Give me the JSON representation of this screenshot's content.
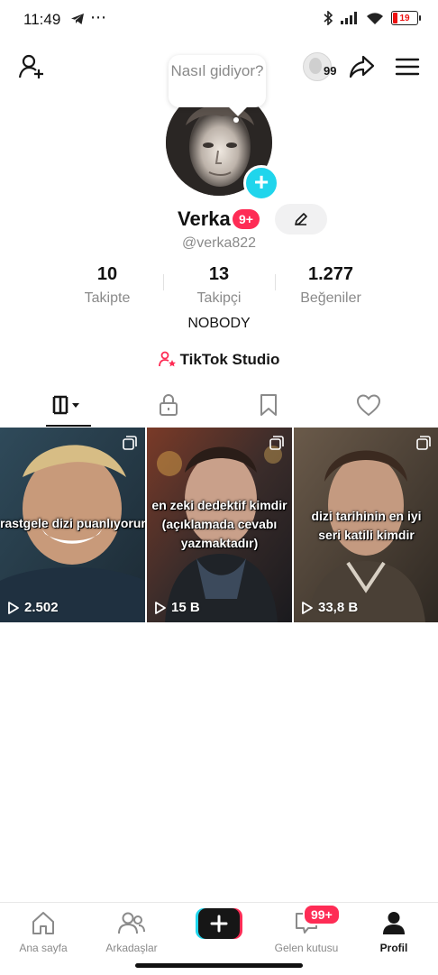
{
  "status_bar": {
    "time": "11:49",
    "battery": "19"
  },
  "header": {
    "friends_count": "99"
  },
  "profile": {
    "bubble_text": "Nasıl gidiyor?",
    "name": "Verka",
    "name_badge": "9+",
    "handle": "@verka822",
    "bio": "NOBODY",
    "studio_label": "TikTok Studio"
  },
  "stats": [
    {
      "value": "10",
      "label": "Takipte"
    },
    {
      "value": "13",
      "label": "Takipçi"
    },
    {
      "value": "1.277",
      "label": "Beğeniler"
    }
  ],
  "tabs": [
    {
      "icon": "grid-icon"
    },
    {
      "icon": "lock-icon"
    },
    {
      "icon": "bookmark-icon"
    },
    {
      "icon": "heart-icon"
    }
  ],
  "videos": [
    {
      "caption_lines": [
        "rastgele dizi puanlıyorum"
      ],
      "views": "2.502"
    },
    {
      "caption_lines": [
        "en zeki dedektif kimdir",
        "(açıklamada cevabı",
        "yazmaktadır)"
      ],
      "views": "15 B"
    },
    {
      "caption_lines": [
        "dizi tarihinin en iyi",
        "seri katili kimdir"
      ],
      "views": "33,8 B"
    }
  ],
  "nav": {
    "home": "Ana sayfa",
    "friends": "Arkadaşlar",
    "inbox": "Gelen kutusu",
    "inbox_badge": "99+",
    "profile": "Profil"
  },
  "colors": {
    "accent": "#fe2c55",
    "cyan": "#20d5ec"
  }
}
